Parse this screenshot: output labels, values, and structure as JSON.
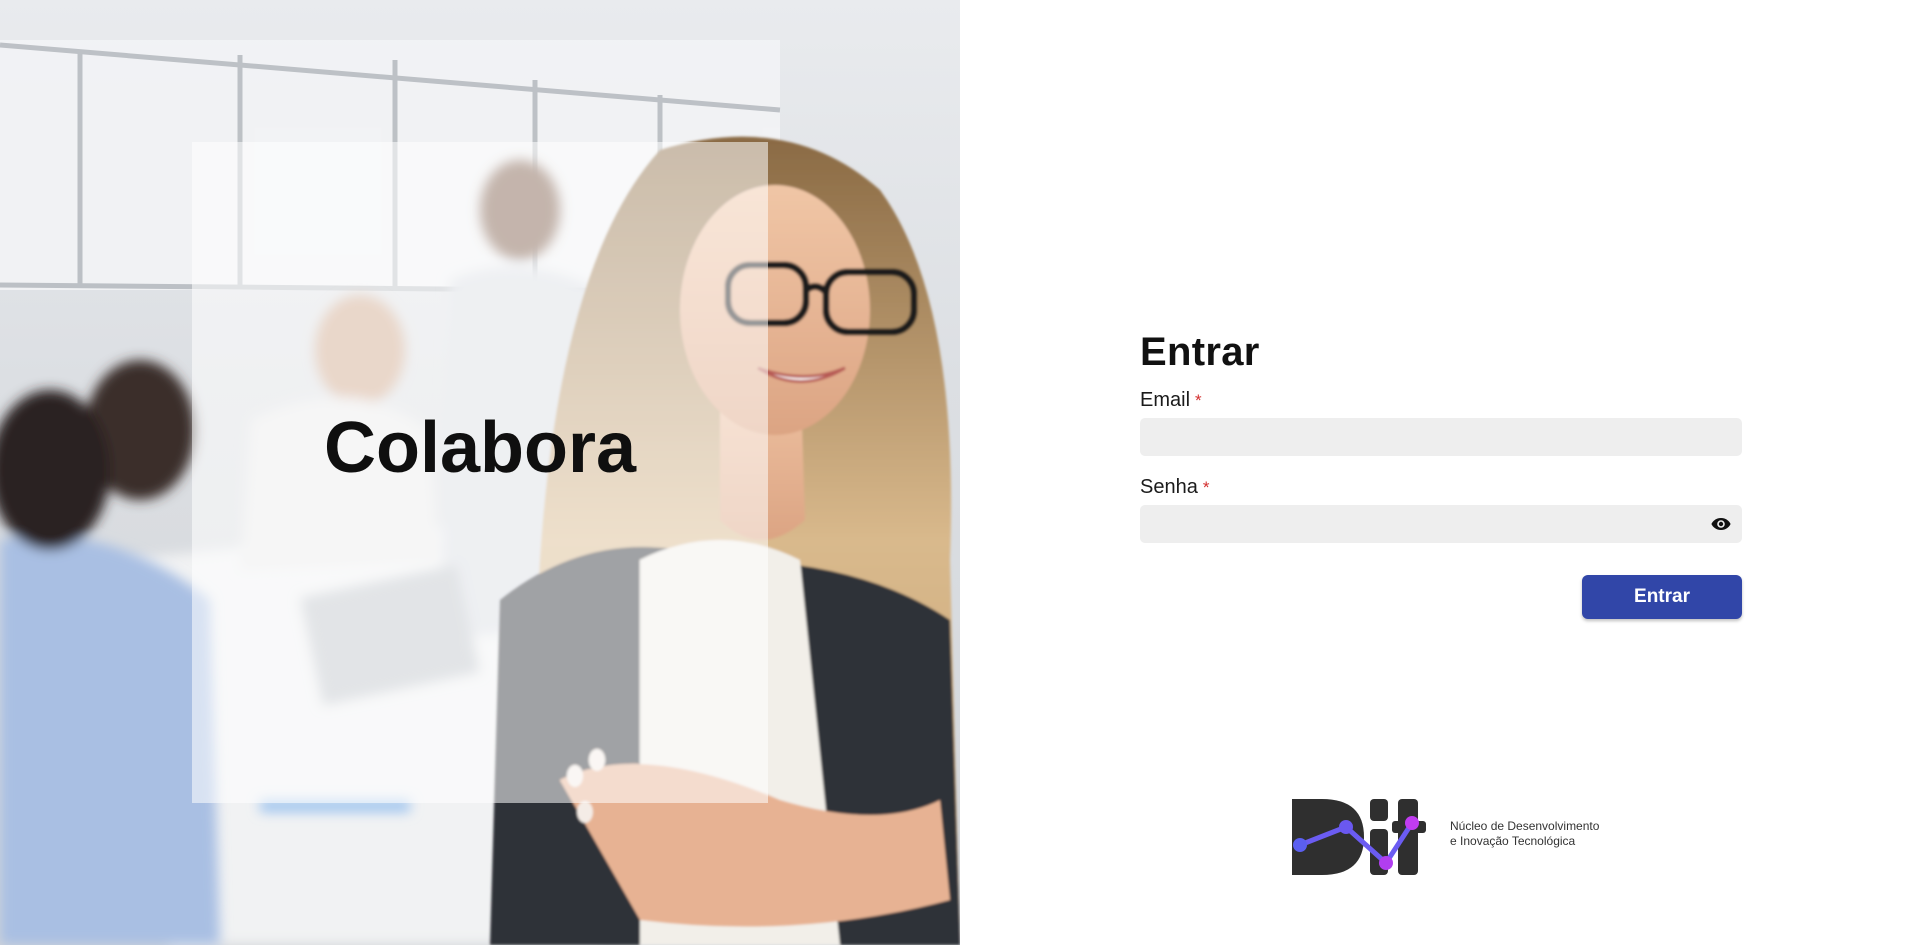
{
  "hero": {
    "title": "Colabora"
  },
  "login": {
    "heading": "Entrar",
    "email": {
      "label": "Email",
      "required_mark": "*",
      "value": "",
      "placeholder": ""
    },
    "password": {
      "label": "Senha",
      "required_mark": "*",
      "value": "",
      "placeholder": "",
      "toggle_icon": "eye-icon"
    },
    "submit_label": "Entrar"
  },
  "logo": {
    "wordmark": "Dit",
    "tagline_line1": "Núcleo de Desenvolvimento",
    "tagline_line2": "e Inovação Tecnológica"
  },
  "colors": {
    "primary_button": "#3146a8",
    "input_bg": "#eeeeee",
    "required": "#d32f2f",
    "logo_dark": "#2f2f2f",
    "logo_blue": "#5b5ff0",
    "logo_purple": "#b13ef0"
  }
}
